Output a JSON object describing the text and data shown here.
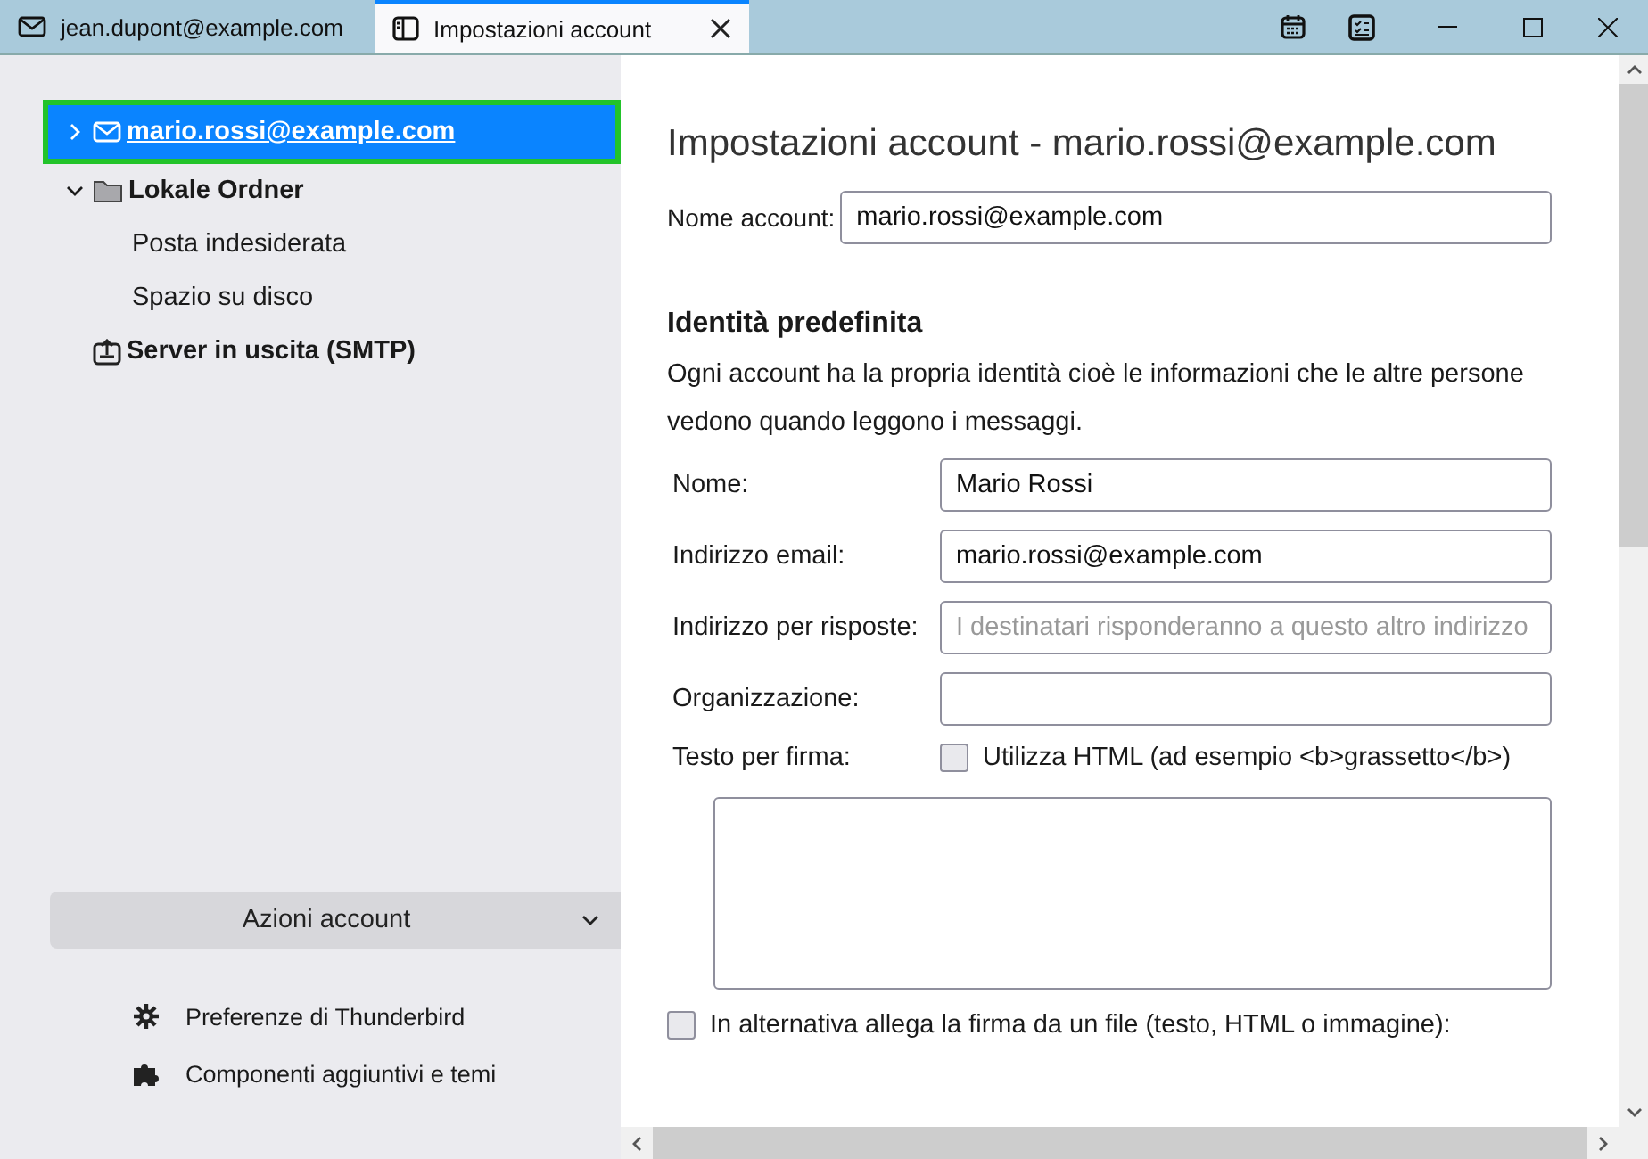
{
  "tabs": [
    {
      "kind": "mail",
      "label": "jean.dupont@example.com",
      "selected": false
    },
    {
      "kind": "settings",
      "label": "Impostazioni account",
      "selected": true
    }
  ],
  "tree": [
    {
      "kind": "mail",
      "label": "mario.rossi@example.com",
      "selected": true,
      "expanded": false
    },
    {
      "kind": "folder",
      "label": "Lokale Ordner",
      "selected": false,
      "expanded": true,
      "children": [
        {
          "label": "Posta indesiderata",
          "selected": false
        },
        {
          "label": "Spazio su disco",
          "selected": false
        }
      ]
    },
    {
      "kind": "outbox",
      "label": "Server in uscita (SMTP)",
      "selected": false
    }
  ],
  "account_actions": "Azioni account",
  "footer_links": [
    {
      "kind": "gear",
      "label": "Preferenze di Thunderbird"
    },
    {
      "kind": "puzzle",
      "label": "Componenti aggiuntivi e temi"
    }
  ],
  "page_title": "Impostazioni account - mario.rossi@example.com",
  "account_name": {
    "label": "Nome account:",
    "value": "mario.rossi@example.com"
  },
  "identity": {
    "heading": "Identità predefinita",
    "description": "Ogni account ha la propria identità cioè le informazioni che le altre persone vedono quando leggono i messaggi.",
    "fields": [
      {
        "label": "Nome:",
        "value": "Mario Rossi"
      },
      {
        "label": "Indirizzo email:",
        "value": "mario.rossi@example.com"
      },
      {
        "label": "Indirizzo per risposte:",
        "placeholder": "I destinatari risponderanno a questo altro indirizzo"
      },
      {
        "label": "Organizzazione:"
      }
    ],
    "signature": {
      "label": "Testo per firma:",
      "html_checkbox": {
        "label": "Utilizza HTML (ad esempio <b>grassetto</b>)",
        "checked": false
      }
    },
    "attach_checkbox": {
      "label": "In alternativa allega la firma da un file (testo, HTML o immagine):",
      "checked": false
    }
  }
}
